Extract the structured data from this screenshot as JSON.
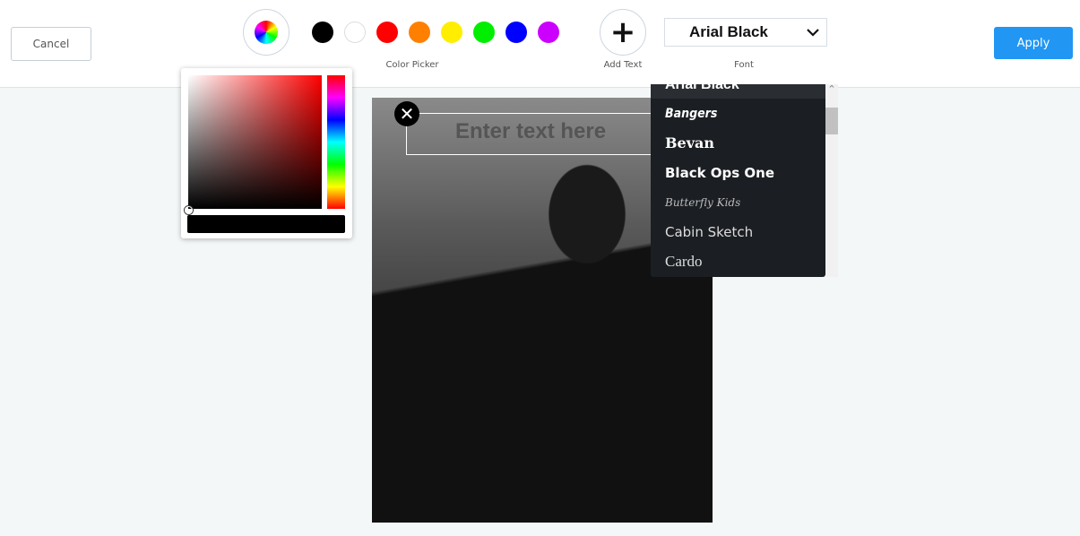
{
  "toolbar": {
    "cancel": "Cancel",
    "apply": "Apply",
    "color_picker_label": "Color Picker",
    "add_text_label": "Add Text",
    "add_text_icon": "+",
    "font_label": "Font",
    "font_value": "Arial Black"
  },
  "swatches": [
    "#000000",
    "#ffffff",
    "#ff0000",
    "#ff8000",
    "#ffee00",
    "#00ee00",
    "#0000ff",
    "#cc00ff"
  ],
  "canvas": {
    "placeholder": "Enter text here",
    "close_icon": "✕"
  },
  "font_options": [
    "Arial Black",
    "Bangers",
    "Bevan",
    "Black Ops One",
    "Butterfly Kids",
    "Cabin Sketch",
    "Cardo"
  ],
  "picker": {
    "current_color": "#000000",
    "hue": "#ff0000"
  }
}
